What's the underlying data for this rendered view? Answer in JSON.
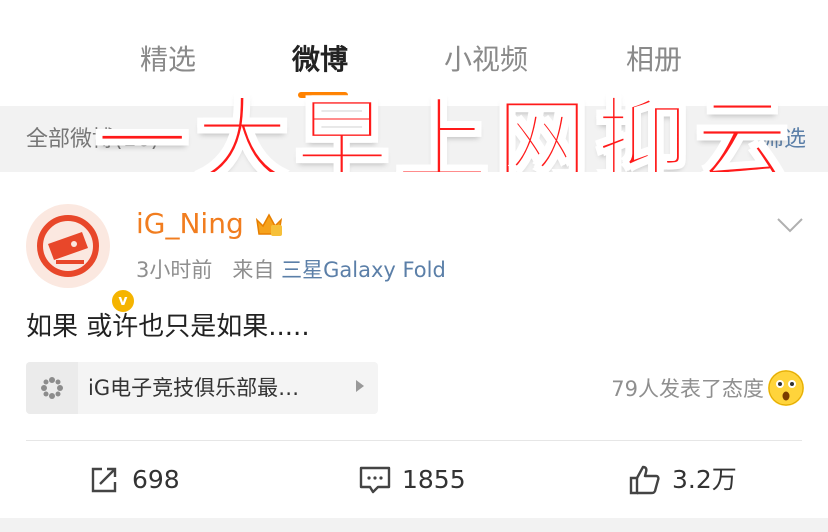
{
  "tabs": [
    {
      "label": "精选"
    },
    {
      "label": "微博"
    },
    {
      "label": "小视频"
    },
    {
      "label": "相册"
    }
  ],
  "filter": {
    "left_label": "全部微博(16)",
    "right_label": "筛选"
  },
  "overlay_title": "一大早上网抑云",
  "post": {
    "username": "iG_Ning",
    "time": "3小时前",
    "source_prefix": "来自",
    "source": "三星Galaxy Fold",
    "content": "如果  或许也只是如果.....",
    "topic": "iG电子竞技俱乐部最…",
    "reactions": "79人发表了态度"
  },
  "actions": {
    "repost_count": "698",
    "comment_count": "1855",
    "like_count": "3.2万"
  },
  "colors": {
    "username": "#f17d1f",
    "source": "#5b7fa8",
    "overlay": "#ff1a1a",
    "verified_badge": "#f5b400"
  },
  "icons": [
    "avatar-logo-icon",
    "verified-badge-icon",
    "crown-vip-icon",
    "chevron-down-icon",
    "topic-icon",
    "surprised-emoji-icon",
    "repost-icon",
    "comment-icon",
    "like-icon"
  ]
}
